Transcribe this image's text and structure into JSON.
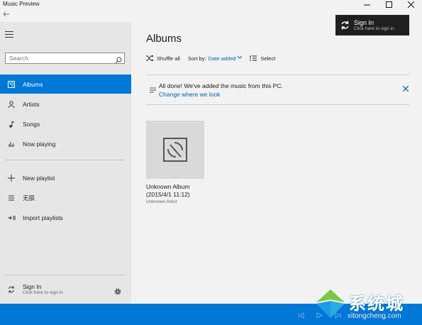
{
  "window": {
    "title": "Music Preview",
    "controls": [
      "minimize-icon",
      "maximize-icon",
      "close-icon"
    ]
  },
  "toast": {
    "title": "Sign In",
    "subtitle": "Click here to sign in"
  },
  "sidebar": {
    "search": {
      "placeholder": "Search"
    },
    "items": [
      {
        "label": "Albums",
        "icon": "albums-icon",
        "active": true
      },
      {
        "label": "Artists",
        "icon": "person-icon",
        "active": false
      },
      {
        "label": "Songs",
        "icon": "music-note-icon",
        "active": false
      },
      {
        "label": "Now playing",
        "icon": "equalizer-icon",
        "active": false
      },
      {
        "label": "New playlist",
        "icon": "plus-icon",
        "active": false
      },
      {
        "label": "无损",
        "icon": "playlist-icon",
        "active": false
      },
      {
        "label": "Import playlists",
        "icon": "import-icon",
        "active": false
      }
    ],
    "signin": {
      "title": "Sign In",
      "subtitle": "Click here to sign in"
    }
  },
  "main": {
    "title": "Albums",
    "toolbar": {
      "shuffle": "Shuffle all",
      "sort_label": "Sort by:",
      "sort_value": "Date added",
      "select": "Select"
    },
    "notice": {
      "message": "All done! We've added the music from this PC.",
      "link": "Change where we look"
    },
    "albums": [
      {
        "title_line1": "Unknown Album",
        "title_line2": "(2015/4/1 11:12)",
        "artist": "Unknown Artist"
      }
    ]
  },
  "watermark": {
    "text": "系统城",
    "url": "xitongcheng.com"
  },
  "colors": {
    "accent": "#0078d7",
    "link": "#0063b1",
    "sidebar_bg": "#e6e6e6",
    "content_bg": "#f2f2f2"
  }
}
